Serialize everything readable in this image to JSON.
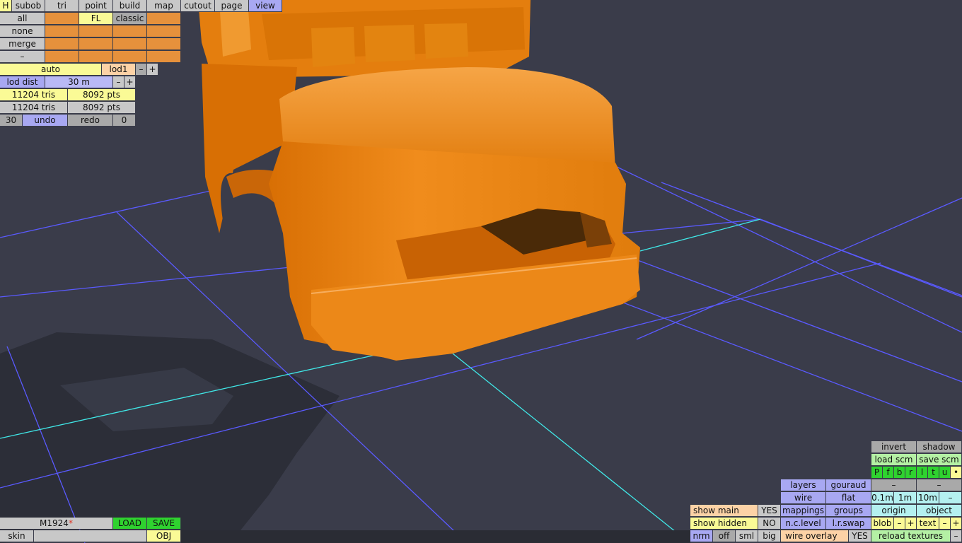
{
  "menu": {
    "h": "H",
    "subob": "subob",
    "tri": "tri",
    "point": "point",
    "build": "build",
    "map": "map",
    "cutout": "cutout",
    "page": "page",
    "view": "view"
  },
  "subob": {
    "all": "all",
    "fl": "FL",
    "classic": "classic",
    "none": "none",
    "merge": "merge",
    "dash": "–"
  },
  "lod": {
    "auto": "auto",
    "lod1": "lod1",
    "minus": "–",
    "plus": "+",
    "dist_label": "lod dist",
    "dist_value": "30 m"
  },
  "stats": {
    "tris1": "11204 tris",
    "pts1": "8092 pts",
    "tris2": "11204 tris",
    "pts2": "8092 pts"
  },
  "history": {
    "count": "30",
    "undo": "undo",
    "redo": "redo",
    "redo_count": "0"
  },
  "file": {
    "name": "M1924",
    "modified_mark": "*",
    "load": "LOAD",
    "save": "SAVE",
    "skin": "skin",
    "obj": "OBJ"
  },
  "view_panel": {
    "invert": "invert",
    "shadow": "shadow",
    "load_scm": "load scm",
    "save_scm": "save scm",
    "views": [
      "P",
      "f",
      "b",
      "r",
      "l",
      "t",
      "u",
      "•"
    ],
    "layers": "layers",
    "gouraud": "gouraud",
    "dash": "–",
    "wire": "wire",
    "flat": "flat",
    "s01": "0.1m",
    "s1": "1m",
    "s10": "10m",
    "show_main": "show main",
    "show_main_val": "YES",
    "mappings": "mappings",
    "groups": "groups",
    "origin": "origin",
    "object": "object",
    "show_hidden": "show hidden",
    "show_hidden_val": "NO",
    "nc_level": "n.c.level",
    "lr_swap": "l.r.swap",
    "blob": "blob",
    "text": "text",
    "minus": "–",
    "plus": "+",
    "nrm": "nrm",
    "off": "off",
    "sml": "sml",
    "big": "big",
    "wire_overlay": "wire overlay",
    "wire_overlay_val": "YES",
    "reload_textures": "reload textures"
  },
  "colors": {
    "background": "#3a3c4a",
    "grid": "#5a5aff",
    "axis": "#40e8e8",
    "model": "#ee8410"
  }
}
